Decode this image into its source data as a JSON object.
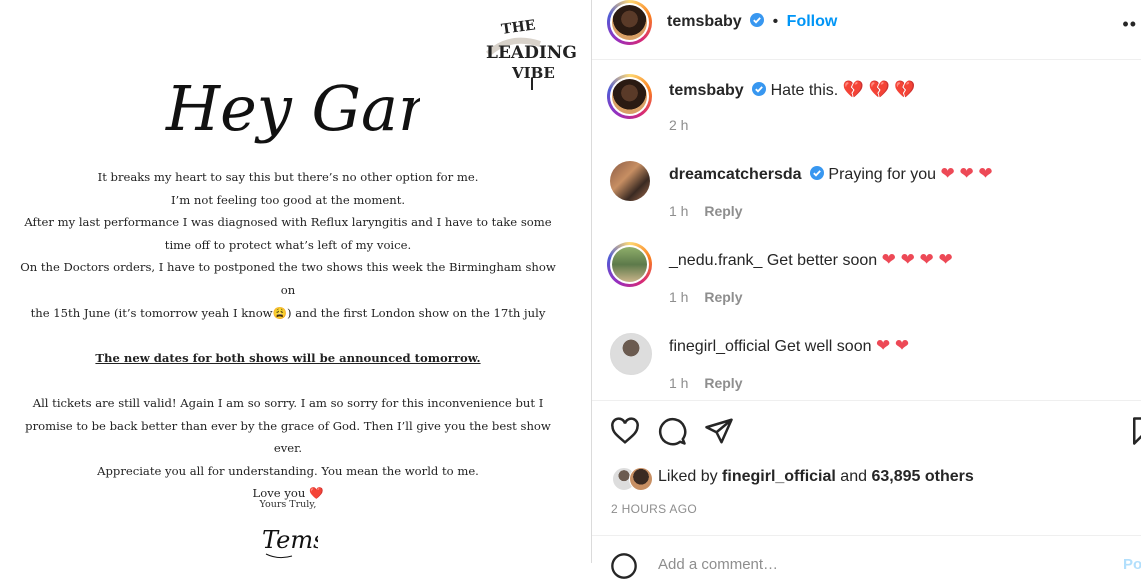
{
  "post": {
    "logo_text": "THE LEADING VIBE",
    "greeting": "Hey Gang,",
    "letter_lines": [
      "It breaks my heart to say this but there’s no other option for me.",
      "I’m not feeling too good at the moment.",
      "After my last performance I was diagnosed with Reflux laryngitis and I have to take some",
      "time off to protect what’s left of my voice.",
      "On the Doctors orders, I have to postponed the two shows this week the Birmingham show on",
      "the 15th June (it’s tomorrow yeah I know😩) and the first London show on the 17th july"
    ],
    "announcement": "The new dates for both shows will be announced tomorrow.",
    "closing_lines": [
      "All tickets are still valid! Again I am so sorry. I am so sorry for this inconvenience but I",
      "promise to be back better than ever by the grace of God. Then I’ll give you the best show ever.",
      "Appreciate you all for understanding. You mean the world to me.",
      "Love you ❤️"
    ],
    "sign_off": "Yours Truly,",
    "signature": "Tems"
  },
  "header": {
    "username": "temsbaby",
    "separator": "•",
    "follow_label": "Follow",
    "more_icon": "more-options-icon"
  },
  "comments": [
    {
      "username": "temsbaby",
      "verified": true,
      "text": "Hate this.",
      "emoji": "💔 💔 💔",
      "time": "2 h",
      "reply": ""
    },
    {
      "username": "dreamcatchersda",
      "verified": true,
      "text": "Praying for you",
      "emoji": "❤ ❤ ❤",
      "time": "1 h",
      "reply": "Reply"
    },
    {
      "username": "_nedu.frank_",
      "verified": false,
      "text": "Get better soon",
      "emoji": "❤ ❤ ❤ ❤",
      "time": "1 h",
      "reply": "Reply"
    },
    {
      "username": "finegirl_official",
      "verified": false,
      "text": "Get well soon",
      "emoji": "❤ ❤",
      "time": "1 h",
      "reply": "Reply"
    }
  ],
  "actions": {
    "like_icon": "heart-icon",
    "comment_icon": "comment-icon",
    "share_icon": "share-icon",
    "save_icon": "bookmark-icon",
    "liked_by_prefix": "Liked by",
    "liked_by_user": "finegirl_official",
    "liked_by_middle": "and",
    "liked_by_count": "63,895 others",
    "timestamp": "2 HOURS AGO",
    "add_comment_placeholder": "Add a comment…",
    "post_label": "Post"
  },
  "colors": {
    "accent": "#0095f6",
    "verified": "#3897f0",
    "heart": "#ed4956",
    "muted": "#8e8e8e"
  }
}
